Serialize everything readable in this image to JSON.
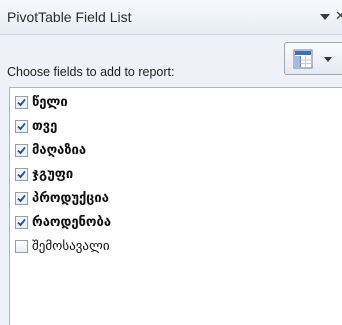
{
  "pane": {
    "title": "PivotTable Field List",
    "menu_icon": "dropdown-arrow-icon",
    "close_icon": "close-icon"
  },
  "choose_label": "Choose fields to add to report:",
  "layout_button": {
    "icon": "field-layout-icon",
    "chevron": "chevron-down-icon"
  },
  "fields": [
    {
      "label": "წელი",
      "checked": true
    },
    {
      "label": "თვე",
      "checked": true
    },
    {
      "label": "მაღაზია",
      "checked": true
    },
    {
      "label": "ჯგუფი",
      "checked": true
    },
    {
      "label": "პროდუქცია",
      "checked": true
    },
    {
      "label": "რაოდენობა",
      "checked": true
    },
    {
      "label": "შემოსავალი",
      "checked": false
    }
  ],
  "colors": {
    "accent": "#1f4e9c",
    "pane_bg": "#eef2f8",
    "border": "#a9b6c8"
  }
}
